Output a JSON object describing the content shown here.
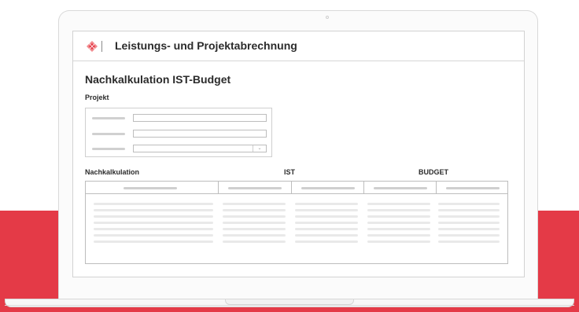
{
  "app": {
    "title": "Leistungs- und Projektabrechnung",
    "logo_colors": [
      "#e43a47",
      "#f28b8f"
    ]
  },
  "page": {
    "title": "Nachkalkulation IST-Budget",
    "project_label": "Projekt",
    "project_fields": [
      "text-field",
      "text-field",
      "dropdown"
    ],
    "columns": {
      "nachkalkulation": "Nachkalkulation",
      "ist": "IST",
      "budget": "BUDGET"
    }
  },
  "theme": {
    "accent": "#e43a47",
    "border": "#bdbdbd",
    "placeholder_bar": "#d0d0d0"
  }
}
